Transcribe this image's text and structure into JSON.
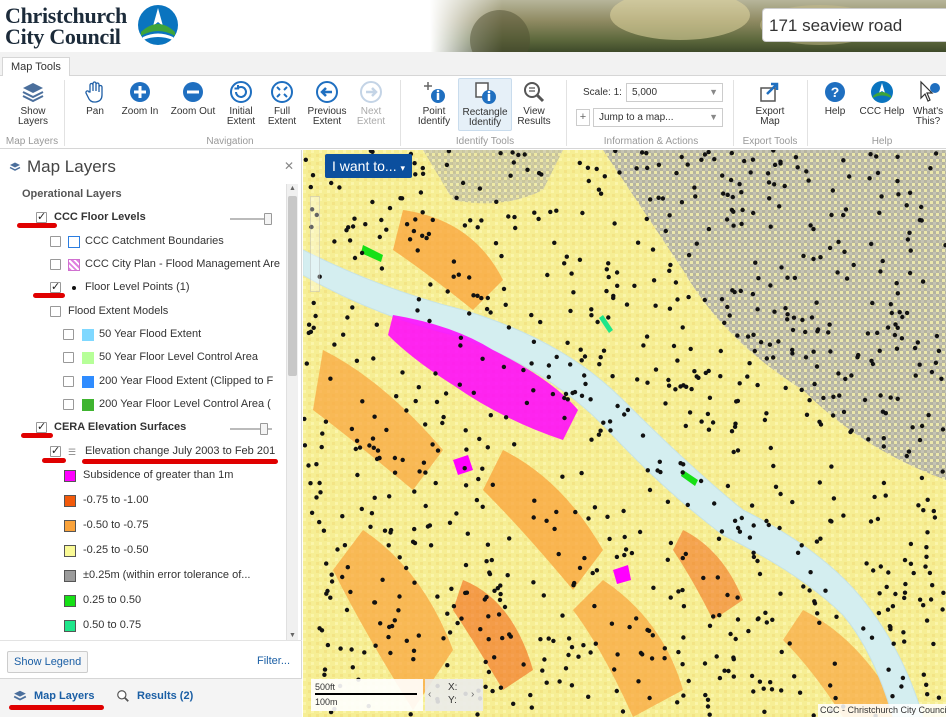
{
  "header": {
    "logo_line1": "Christchurch",
    "logo_line2": "City Council",
    "search_value": "171 seaview road"
  },
  "ribbon": {
    "tab_label": "Map Tools",
    "buttons": {
      "show_layers": "Show Layers",
      "pan": "Pan",
      "zoom_in": "Zoom In",
      "zoom_out": "Zoom Out",
      "initial_extent": "Initial Extent",
      "full_extent": "Full Extent",
      "previous_extent": "Previous Extent",
      "next_extent": "Next Extent",
      "point_identify": "Point Identify",
      "rectangle_identify": "Rectangle Identify",
      "view_results": "View Results",
      "export_map": "Export Map",
      "help": "Help",
      "ccc_help": "CCC Help",
      "whats_this": "What's This?"
    },
    "groups": {
      "map_layers": "Map Layers",
      "navigation": "Navigation",
      "identify_tools": "Identify Tools",
      "information_actions": "Information & Actions",
      "export_tools": "Export Tools",
      "help": "Help"
    },
    "scale_label": "Scale: 1:",
    "scale_value": "5,000",
    "jump_placeholder": "Jump to a map..."
  },
  "panel": {
    "title": "Map Layers",
    "section": "Operational Layers",
    "layers": {
      "floor_levels": "CCC Floor Levels",
      "catchment": "CCC Catchment Boundaries",
      "city_plan": "CCC City Plan - Flood Management Are",
      "floor_points": "Floor Level Points (1)",
      "flood_models": "Flood Extent Models",
      "flood50": "50 Year Flood Extent",
      "floor50": "50 Year Floor Level Control Area",
      "flood200": "200 Year Flood Extent (Clipped to F",
      "floor200": "200 Year Floor Level Control Area (",
      "cera": "CERA Elevation Surfaces",
      "elev_change": "Elevation change July 2003 to Feb 201"
    },
    "legend": [
      {
        "label": "Subsidence of greater than 1m",
        "color": "#ff00ff"
      },
      {
        "label": "-0.75 to -1.00",
        "color": "#f25a0a"
      },
      {
        "label": "-0.50 to -0.75",
        "color": "#f9a23a"
      },
      {
        "label": "-0.25 to -0.50",
        "color": "#fafa96"
      },
      {
        "label": "±0.25m (within error tolerance of...",
        "color": "#9b9b9b"
      },
      {
        "label": "0.25 to 0.50",
        "color": "#16e016"
      },
      {
        "label": "0.50 to 0.75",
        "color": "#1ee68a"
      }
    ],
    "show_legend": "Show Legend",
    "filter": "Filter...",
    "tab_layers": "Map Layers",
    "tab_results": "Results (2)"
  },
  "map": {
    "iwant": "I want to...",
    "scale_ft": "500ft",
    "scale_m": "100m",
    "x_label": "X:",
    "y_label": "Y:",
    "attribution": "CCC - Christchurch City Council"
  },
  "colors": {
    "accent": "#0b4f9e",
    "link": "#1b5fa5",
    "annotation": "#e00000"
  }
}
